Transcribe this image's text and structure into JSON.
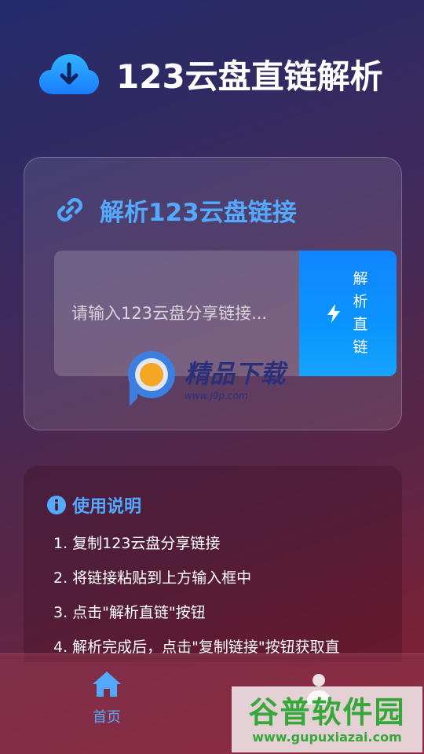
{
  "header": {
    "title": "123云盘直链解析",
    "icon": "cloud-download-icon"
  },
  "parse_card": {
    "title": "解析123云盘链接",
    "title_icon": "link-icon",
    "input_placeholder": "请输入123云盘分享链接...",
    "input_value": "",
    "button_icon": "bolt-icon",
    "button_label": "解析直链"
  },
  "instructions": {
    "title": "使用说明",
    "title_icon": "info-icon",
    "steps": [
      "1. 复制123云盘分享链接",
      "2. 将链接粘贴到上方输入框中",
      "3. 点击\"解析直链\"按钮",
      "4. 解析完成后，点击\"复制链接\"按钮获取直"
    ]
  },
  "bottom_nav": {
    "home_label": "首页",
    "home_icon": "home-icon",
    "user_icon": "user-icon"
  },
  "watermarks": {
    "j9p_name": "精品下载",
    "j9p_url": "www.j9p.com",
    "gupu_name": "谷普软件园",
    "gupu_url": "www.gupuxiazai.com"
  },
  "colors": {
    "accent": "#54a9ff",
    "button": "#0a94ff",
    "background_top": "#232b6b",
    "background_bottom": "#8b1e2e"
  }
}
